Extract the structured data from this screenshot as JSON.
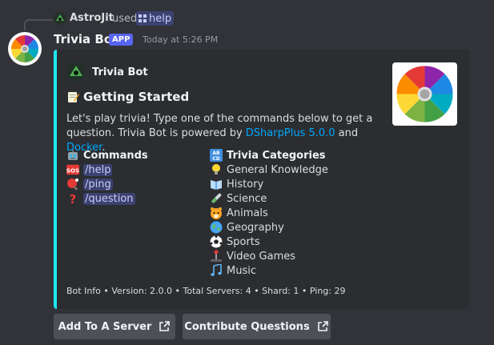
{
  "reply": {
    "user": "AstroJit",
    "used_text": "used",
    "command": "help"
  },
  "message": {
    "author": "Trivia Bot",
    "badge": "APP",
    "timestamp": "Today at 5:26 PM"
  },
  "embed": {
    "author_name": "Trivia Bot",
    "title": "Getting Started",
    "description_pre": "Let's play trivia! Type one of the commands below to get a question. Trivia Bot is powered by ",
    "link1": "DSharpPlus 5.0.0",
    "description_mid": " and ",
    "link2": "Docker",
    "description_post": ".",
    "accent_color": "#1ee6f0",
    "fields": {
      "commands": {
        "name": "Commands",
        "items": [
          "/help",
          "/ping",
          "/question"
        ],
        "icons": [
          "sos-icon",
          "ping-pong-icon",
          "question-icon"
        ]
      },
      "categories": {
        "name": "Trivia Categories",
        "items": [
          "General Knowledge",
          "History",
          "Science",
          "Animals",
          "Geography",
          "Sports",
          "Video Games",
          "Music"
        ],
        "icons": [
          "lightbulb-icon",
          "book-icon",
          "test-tube-icon",
          "tiger-icon",
          "globe-icon",
          "soccer-ball-icon",
          "joystick-icon",
          "music-notes-icon"
        ]
      }
    },
    "footer": "Bot Info • Version: 2.0.0 • Total Servers: 4 • Shard: 1 • Ping: 29"
  },
  "buttons": {
    "add": "Add To A Server",
    "contribute": "Contribute Questions"
  }
}
